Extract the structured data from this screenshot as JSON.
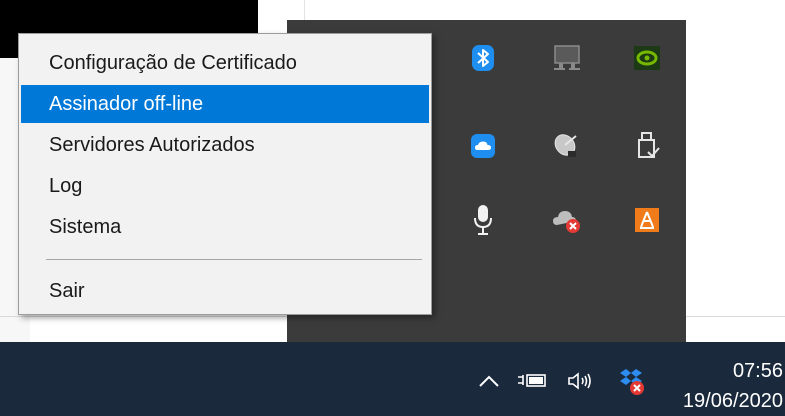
{
  "context_menu": {
    "items": [
      {
        "label": "Configuração de Certificado"
      },
      {
        "label": "Assinador off-line",
        "highlighted": true
      },
      {
        "label": "Servidores Autorizados"
      },
      {
        "label": "Log"
      },
      {
        "label": "Sistema"
      }
    ],
    "exit": {
      "label": "Sair"
    }
  },
  "tray_flyout": {
    "icons": [
      "bluetooth-icon",
      "network-monitor-icon",
      "nvidia-icon",
      "cloud-icon",
      "satellite-dish-icon",
      "usb-drive-icon",
      "microphone-icon",
      "cloud-error-icon",
      "security-app-icon"
    ]
  },
  "taskbar": {
    "icons": [
      "show-hidden-icons-chevron",
      "power-battery-icon",
      "volume-icon",
      "dropbox-error-icon"
    ],
    "clock": {
      "time": "07:56",
      "date": "19/06/2020"
    }
  },
  "colors": {
    "menu_highlight": "#0078d7",
    "tray_flyout_bg": "#3b3b3b",
    "taskbar_bg": "#1a2a3c"
  }
}
